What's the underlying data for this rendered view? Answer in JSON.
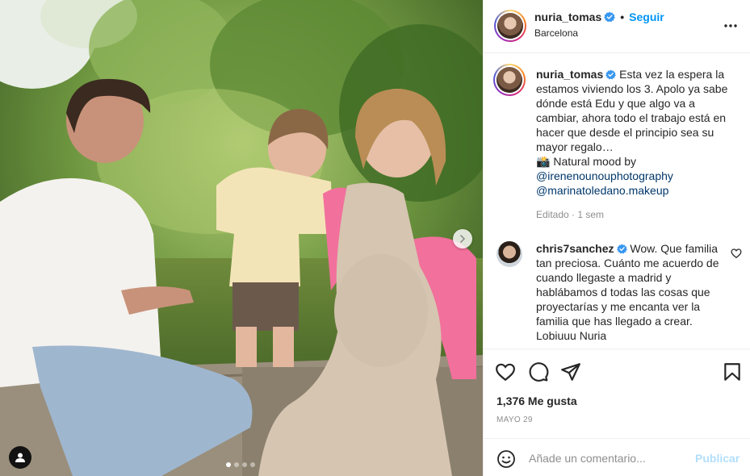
{
  "post": {
    "username": "nuria_tomas",
    "follow_label": "Seguir",
    "separator": "•",
    "location": "Barcelona",
    "caption_text": "Esta vez la espera la estamos viviendo los 3. Apolo ya sabe dónde está Edu y que algo va a cambiar, ahora todo el trabajo está en hacer que desde el principio sea su mayor regalo…",
    "caption_camera": "📸",
    "caption_mood": "Natural mood by",
    "mention_1": "@irenenounouphotography",
    "mention_2": "@marinatoledano.makeup",
    "edited_meta": "Editado · 1 sem",
    "likes": "1,376 Me gusta",
    "date": "MAYO 29"
  },
  "comment": {
    "username": "chris7sanchez",
    "text": "Wow. Que familia tan preciosa. Cuánto me acuerdo de cuando llegaste a madrid y hablábamos d todas las cosas que proyectarías y me encanta ver la familia que has llegado a crear. Lobiuuu Nuria"
  },
  "add_comment": {
    "placeholder": "Añade un comentario...",
    "publish_label": "Publicar"
  },
  "carousel": {
    "current": 1,
    "total": 4
  },
  "colors": {
    "accent": "#0095f6",
    "verified": "#3897f0",
    "publish_disabled": "#b2dffc",
    "link": "#00376b",
    "muted": "#8e8e8e"
  },
  "icons": [
    "more-icon",
    "heart-icon",
    "comment-icon",
    "share-icon",
    "bookmark-icon",
    "emoji-icon",
    "next-arrow-icon",
    "user-tag-icon",
    "verified-icon"
  ]
}
